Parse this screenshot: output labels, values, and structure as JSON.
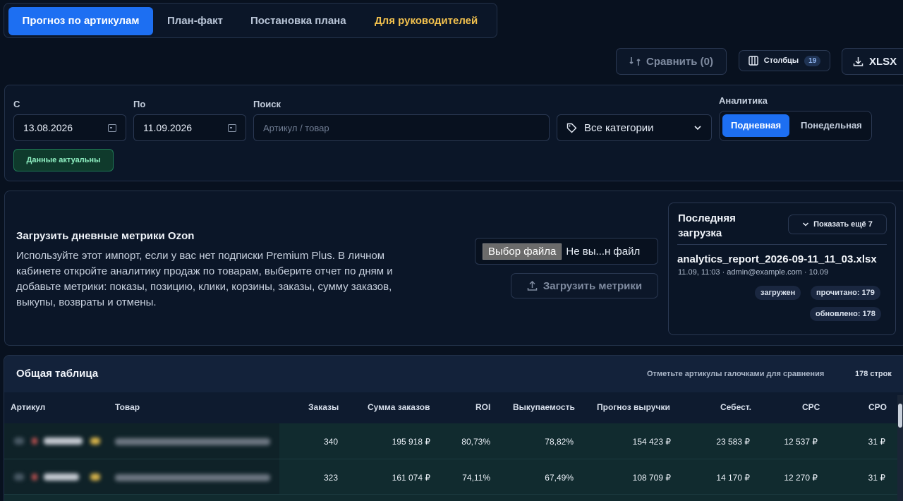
{
  "tabs": [
    {
      "label": "Прогноз по артикулам",
      "active": true
    },
    {
      "label": "План-факт"
    },
    {
      "label": "Постановка плана"
    },
    {
      "label": "Для руководителей",
      "color": "#f2c14e"
    }
  ],
  "toolbar": {
    "compare_label": "Сравнить (0)",
    "columns_label": "Столбцы",
    "columns_count": "19",
    "xlsx_label": "XLSX"
  },
  "filters": {
    "from_label": "С",
    "from_value": "13.08.2026",
    "to_label": "По",
    "to_value": "11.09.2026",
    "search_label": "Поиск",
    "search_placeholder": "Артикул / товар",
    "category_value": "Все категории",
    "analytics_label": "Аналитика",
    "analytics_daily": "Подневная",
    "analytics_weekly": "Понедельная",
    "status": "Данные актуальны"
  },
  "import": {
    "title": "Загрузить дневные метрики Ozon",
    "description": "Используйте этот импорт, если у вас нет подписки Premium Plus. В личном кабинете откройте аналитику продаж по товарам, выберите отчет по дням и добавьте метрики: показы, позицию, клики, корзины, заказы, сумму заказов, выкупы, возвраты и отмены.",
    "file_button": "Выбор файла",
    "file_status": "Не вы...н файл",
    "upload_label": "Загрузить метрики"
  },
  "last_upload": {
    "title_line1": "Последняя",
    "title_line2": "загрузка",
    "show_more": "Показать ещё 7",
    "file_name": "analytics_report_2026-09-11_11_03.xlsx",
    "meta": "11.09, 11:03 · admin@example.com · 10.09",
    "status": "загружен",
    "read": "прочитано: 179",
    "updated": "обновлено: 178"
  },
  "table": {
    "title": "Общая таблица",
    "hint": "Отметьте артикулы галочками для сравнения",
    "rows_count": "178 строк",
    "columns": [
      "Артикул",
      "Товар",
      "Заказы",
      "Сумма заказов",
      "ROI",
      "Выкупаемость",
      "Прогноз выручки",
      "Себест.",
      "CPC",
      "CPO"
    ],
    "rows": [
      {
        "orders": "340",
        "sum": "195 918 ₽",
        "roi": "80,73%",
        "buyout": "78,82%",
        "forecast": "154 423 ₽",
        "cost": "23 583 ₽",
        "cpc": "12 537 ₽",
        "cpo": "31 ₽"
      },
      {
        "orders": "323",
        "sum": "161 074 ₽",
        "roi": "74,11%",
        "buyout": "67,49%",
        "forecast": "108 709 ₽",
        "cost": "14 170 ₽",
        "cpc": "12 270 ₽",
        "cpo": "31 ₽"
      }
    ]
  }
}
